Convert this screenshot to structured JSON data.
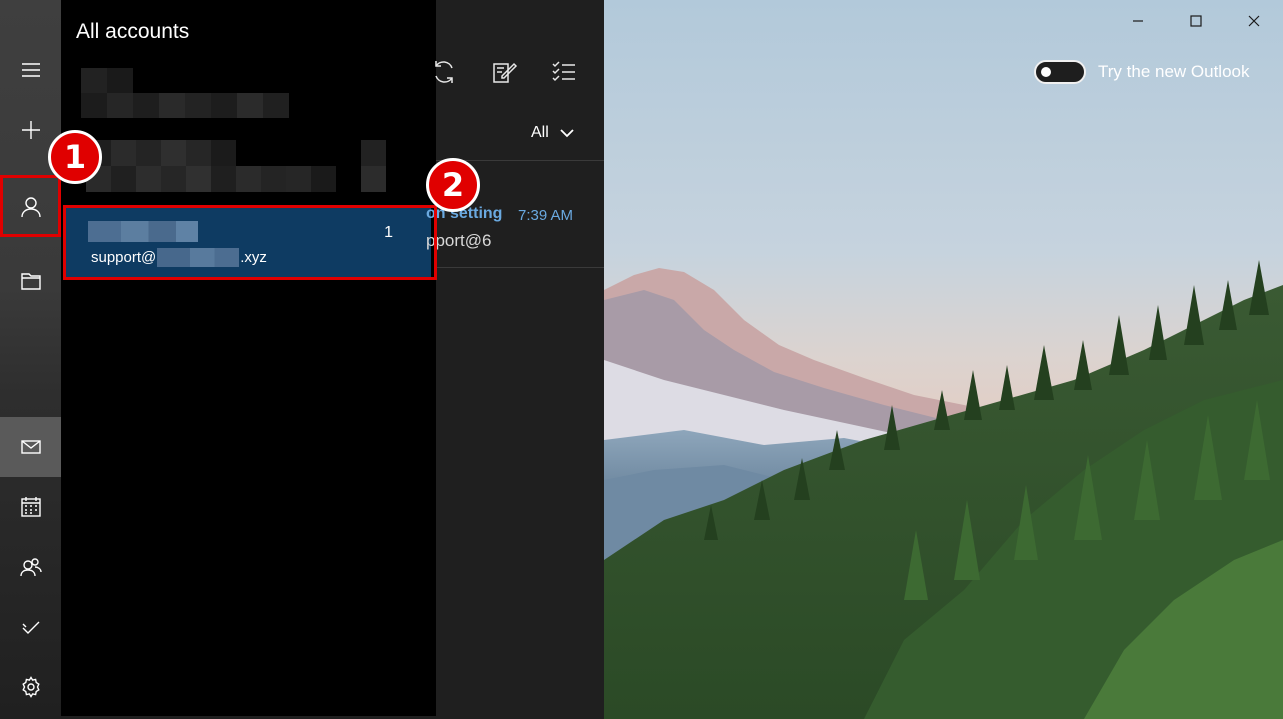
{
  "flyout": {
    "title": "All accounts",
    "account": {
      "unread_count": "1",
      "email_prefix": "support@",
      "email_suffix": ".xyz"
    }
  },
  "list": {
    "filter_label": "All",
    "message": {
      "subject": "on setting",
      "time": "7:39 AM",
      "sender": "pport@6"
    }
  },
  "reading": {
    "try_new_outlook_label": "Try the new Outlook",
    "toggle_on": false
  },
  "annotations": {
    "step1": "1",
    "step2": "2",
    "color": "#e00000"
  },
  "icons": {
    "rail": [
      "hamburger-menu-icon",
      "add-icon",
      "person-icon",
      "folder-icon",
      "mail-icon",
      "calendar-icon",
      "people-icon",
      "todo-icon",
      "settings-gear-icon"
    ],
    "toolbar": [
      "sync-icon",
      "compose-icon",
      "select-checklist-icon"
    ],
    "window": [
      "minimize-icon",
      "maximize-icon",
      "close-icon"
    ]
  }
}
